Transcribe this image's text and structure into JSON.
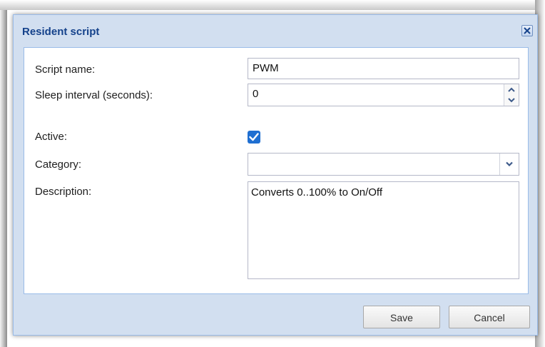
{
  "dialog": {
    "title": "Resident script"
  },
  "form": {
    "script_name_label": "Script name:",
    "script_name_value": "PWM",
    "sleep_interval_label": "Sleep interval (seconds):",
    "sleep_interval_value": "0",
    "active_label": "Active:",
    "active_checked": true,
    "category_label": "Category:",
    "category_value": "",
    "description_label": "Description:",
    "description_value": "Converts 0..100% to On/Off"
  },
  "buttons": {
    "save_label": "Save",
    "cancel_label": "Cancel"
  },
  "icons": {
    "close": "close-icon",
    "spinner_up": "chevron-up-icon",
    "spinner_down": "chevron-down-icon",
    "combo": "chevron-down-icon",
    "checkmark": "checkmark-icon"
  },
  "colors": {
    "title_text": "#15428b",
    "dialog_bg": "#d2dff0",
    "checkbox_accent": "#1f6fd1"
  }
}
